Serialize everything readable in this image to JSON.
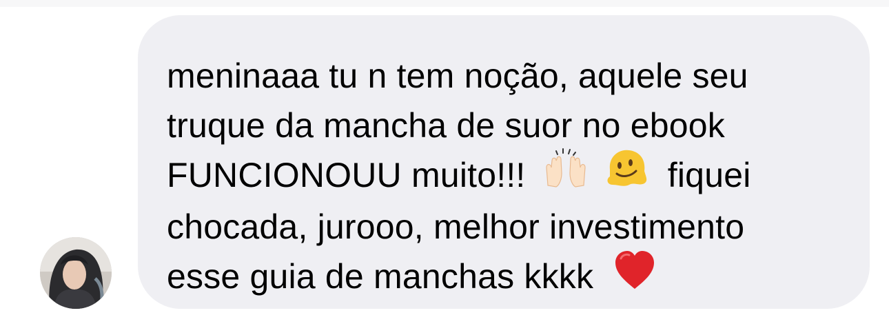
{
  "message": {
    "lines": [
      "meninaaa tu n tem noção, aquele seu",
      "truque da mancha de suor no ebook",
      "FUNCIONOUU muito!!!",
      "fiquei",
      "chocada, jurooo, melhor investimento",
      "esse guia de manchas kkkk"
    ]
  },
  "icons": {
    "raising_hands": "raising-hands-emoji",
    "melting_face": "melting-face-emoji",
    "heart": "red-heart-emoji",
    "avatar": "sender-avatar"
  },
  "colors": {
    "bubble": "#efeff3",
    "text": "#000000",
    "heart": "#e0242a"
  }
}
